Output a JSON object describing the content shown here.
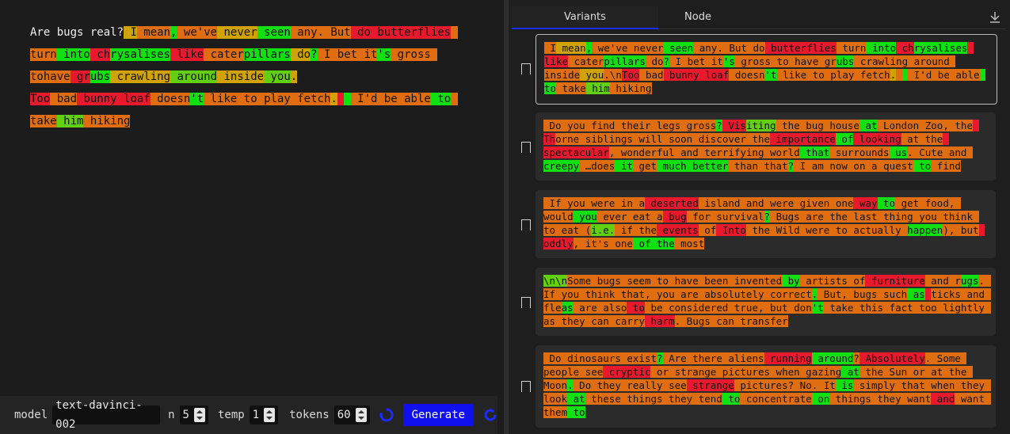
{
  "colors": {
    "red": "#e8192d",
    "orange": "#e06d10",
    "amber": "#d0a300",
    "olive": "#a6c010",
    "green": "#10e010",
    "lime": "#62d010"
  },
  "editor": {
    "prompt": "Are bugs real?",
    "tokens": [
      [
        " I",
        "a"
      ],
      [
        " mean",
        "o"
      ],
      [
        ",",
        "g"
      ],
      [
        " we",
        "o"
      ],
      [
        "'ve",
        "o"
      ],
      [
        " never",
        "a"
      ],
      [
        " seen",
        "g"
      ],
      [
        " any",
        "o"
      ],
      [
        ".",
        "o"
      ],
      [
        " But",
        "o"
      ],
      [
        " do",
        "r"
      ],
      [
        " butterflies",
        "r"
      ],
      [
        " ",
        "o"
      ],
      [
        "turn",
        "o"
      ],
      [
        " into",
        "g"
      ],
      [
        " ch",
        "r"
      ],
      [
        "rysalises",
        "g"
      ],
      [
        " like",
        "r"
      ],
      [
        " cater",
        "o"
      ],
      [
        "pillars",
        "g"
      ],
      [
        " do",
        "a"
      ],
      [
        "?",
        "g"
      ],
      [
        " I",
        "o"
      ],
      [
        " bet",
        "o"
      ],
      [
        " it",
        "o"
      ],
      [
        "'s",
        "g"
      ],
      [
        " gross",
        "o"
      ],
      [
        " to",
        "o"
      ],
      [
        "have",
        "o"
      ],
      [
        " gr",
        "r"
      ],
      [
        "ubs",
        "g"
      ],
      [
        " crawling",
        "a"
      ],
      [
        " around",
        "l"
      ],
      [
        " inside",
        "a"
      ],
      [
        " you",
        "l"
      ],
      [
        ".\n",
        "a"
      ],
      [
        "Too",
        "r"
      ],
      [
        " bad",
        "o"
      ],
      [
        " bunny",
        "r"
      ],
      [
        " loaf",
        "r"
      ],
      [
        " doesn",
        "o"
      ],
      [
        "'t",
        "g"
      ],
      [
        " like",
        "o"
      ],
      [
        " to",
        "o"
      ],
      [
        " play",
        "o"
      ],
      [
        " fetch",
        "o"
      ],
      [
        ".",
        "a"
      ],
      [
        " ",
        "r"
      ],
      [
        " ",
        "g"
      ],
      [
        " I",
        "o"
      ],
      [
        "'d",
        "o"
      ],
      [
        " be",
        "o"
      ],
      [
        " able",
        "o"
      ],
      [
        " to",
        "g"
      ],
      [
        " ",
        "o"
      ],
      [
        "take",
        "o"
      ],
      [
        " him",
        "l"
      ],
      [
        " hiking",
        "o"
      ]
    ]
  },
  "controls": {
    "model_label": "model",
    "model_value": "text-davinci-002",
    "n_label": "n",
    "n_value": "5",
    "temp_label": "temp",
    "temp_value": "1",
    "tokens_label": "tokens",
    "tokens_value": "60",
    "generate_label": "Generate"
  },
  "tabs": {
    "variants": "Variants",
    "node": "Node"
  },
  "variants": [
    {
      "tokens": [
        [
          " I",
          "o"
        ],
        [
          " mean",
          "a"
        ],
        [
          ",",
          "g"
        ],
        [
          " we",
          "o"
        ],
        [
          "'ve",
          "o"
        ],
        [
          " never",
          "o"
        ],
        [
          " seen",
          "g"
        ],
        [
          " any",
          "o"
        ],
        [
          ".",
          "o"
        ],
        [
          " But",
          "o"
        ],
        [
          " do",
          "o"
        ],
        [
          " butterflies",
          "r"
        ],
        [
          " turn",
          "o"
        ],
        [
          " into",
          "g"
        ],
        [
          " ch",
          "r"
        ],
        [
          "rysalises",
          "g"
        ],
        [
          " ",
          "r"
        ],
        [
          "like",
          "r"
        ],
        [
          " cater",
          "o"
        ],
        [
          "pillars",
          "g"
        ],
        [
          " do",
          "o"
        ],
        [
          "?",
          "g"
        ],
        [
          " I",
          "o"
        ],
        [
          " bet",
          "o"
        ],
        [
          " it",
          "o"
        ],
        [
          "'s",
          "g"
        ],
        [
          " gross",
          "o"
        ],
        [
          " to",
          "o"
        ],
        [
          " have",
          "o"
        ],
        [
          " gr",
          "o"
        ],
        [
          "ubs",
          "g"
        ],
        [
          " crawling",
          "o"
        ],
        [
          " around",
          "o"
        ],
        [
          " inside",
          "o"
        ],
        [
          " you",
          "a"
        ],
        [
          ".\\n",
          "o"
        ],
        [
          "Too",
          "r"
        ],
        [
          " bad",
          "o"
        ],
        [
          " bunny",
          "r"
        ],
        [
          " loaf",
          "r"
        ],
        [
          " doesn",
          "o"
        ],
        [
          "'t",
          "g"
        ],
        [
          " like",
          "o"
        ],
        [
          " to",
          "o"
        ],
        [
          " play",
          "o"
        ],
        [
          " fetch",
          "o"
        ],
        [
          ".",
          "a"
        ],
        [
          " ",
          "o"
        ],
        [
          " ",
          "g"
        ],
        [
          " I",
          "o"
        ],
        [
          "'d",
          "o"
        ],
        [
          " be",
          "o"
        ],
        [
          " ",
          "o"
        ],
        [
          "able",
          "o"
        ],
        [
          " to",
          "g"
        ],
        [
          " take",
          "o"
        ],
        [
          " him",
          "l"
        ],
        [
          " hiking",
          "o"
        ]
      ]
    },
    {
      "tokens": [
        [
          " Do",
          "o"
        ],
        [
          " you",
          "o"
        ],
        [
          " find",
          "o"
        ],
        [
          " their",
          "o"
        ],
        [
          " legs",
          "o"
        ],
        [
          " gross",
          "o"
        ],
        [
          "?",
          "g"
        ],
        [
          " Vis",
          "r"
        ],
        [
          "iting",
          "l"
        ],
        [
          " the",
          "o"
        ],
        [
          " bug",
          "o"
        ],
        [
          " house",
          "o"
        ],
        [
          " at",
          "g"
        ],
        [
          " London",
          "o"
        ],
        [
          " Zoo",
          "o"
        ],
        [
          ",",
          "o"
        ],
        [
          " ",
          "o"
        ],
        [
          "the",
          "o"
        ],
        [
          " Th",
          "r"
        ],
        [
          "orne",
          "o"
        ],
        [
          " siblings",
          "o"
        ],
        [
          " will",
          "o"
        ],
        [
          " soon",
          "o"
        ],
        [
          " discover",
          "o"
        ],
        [
          " the",
          "o"
        ],
        [
          " importance",
          "r"
        ],
        [
          " of",
          "g"
        ],
        [
          " looking",
          "r"
        ],
        [
          " at",
          "o"
        ],
        [
          " the",
          "o"
        ],
        [
          " ",
          "r"
        ],
        [
          "spectacular",
          "r"
        ],
        [
          ",",
          "o"
        ],
        [
          " wonderful",
          "o"
        ],
        [
          " and",
          "o"
        ],
        [
          " terrifying",
          "o"
        ],
        [
          " world",
          "o"
        ],
        [
          " that",
          "g"
        ],
        [
          " surrounds",
          "o"
        ],
        [
          " us",
          "g"
        ],
        [
          ".",
          "o"
        ],
        [
          " Cute",
          "o"
        ],
        [
          " and",
          "o"
        ],
        [
          " ",
          "o"
        ],
        [
          "creepy",
          "g"
        ],
        [
          " …",
          "o"
        ],
        [
          "does",
          "o"
        ],
        [
          " it",
          "g"
        ],
        [
          " get",
          "o"
        ],
        [
          " much",
          "g"
        ],
        [
          " better",
          "g"
        ],
        [
          " than",
          "o"
        ],
        [
          " that",
          "o"
        ],
        [
          "?",
          "g"
        ],
        [
          " I",
          "o"
        ],
        [
          " am",
          "o"
        ],
        [
          " now",
          "o"
        ],
        [
          " on",
          "o"
        ],
        [
          " a",
          "o"
        ],
        [
          " quest",
          "o"
        ],
        [
          " to",
          "g"
        ],
        [
          " find",
          "o"
        ]
      ]
    },
    {
      "tokens": [
        [
          " If",
          "o"
        ],
        [
          " you",
          "o"
        ],
        [
          " were",
          "o"
        ],
        [
          " in",
          "o"
        ],
        [
          " a",
          "o"
        ],
        [
          " deserted",
          "r"
        ],
        [
          " island",
          "o"
        ],
        [
          " and",
          "o"
        ],
        [
          " were",
          "o"
        ],
        [
          " given",
          "o"
        ],
        [
          " one",
          "o"
        ],
        [
          " way",
          "r"
        ],
        [
          " to",
          "g"
        ],
        [
          " get",
          "o"
        ],
        [
          " food",
          "o"
        ],
        [
          ",",
          "o"
        ],
        [
          " ",
          "o"
        ],
        [
          "would",
          "o"
        ],
        [
          " you",
          "g"
        ],
        [
          " ever",
          "o"
        ],
        [
          " eat",
          "o"
        ],
        [
          " a",
          "o"
        ],
        [
          " bug",
          "r"
        ],
        [
          " for",
          "o"
        ],
        [
          " survival",
          "o"
        ],
        [
          "?",
          "g"
        ],
        [
          " Bugs",
          "o"
        ],
        [
          " are",
          "o"
        ],
        [
          " the",
          "o"
        ],
        [
          " last",
          "o"
        ],
        [
          " thing",
          "o"
        ],
        [
          " you",
          "o"
        ],
        [
          " ",
          "o"
        ],
        [
          "think",
          "o"
        ],
        [
          " to",
          "o"
        ],
        [
          " eat",
          "o"
        ],
        [
          " (",
          "o"
        ],
        [
          "i.e.",
          "l"
        ],
        [
          " if",
          "o"
        ],
        [
          " the",
          "o"
        ],
        [
          " events",
          "r"
        ],
        [
          " of",
          "o"
        ],
        [
          " Into",
          "r"
        ],
        [
          " the",
          "o"
        ],
        [
          " Wild",
          "o"
        ],
        [
          " were",
          "o"
        ],
        [
          " to",
          "o"
        ],
        [
          " actually",
          "o"
        ],
        [
          " ",
          "o"
        ],
        [
          "happen",
          "g"
        ],
        [
          "),",
          "o"
        ],
        [
          " but",
          "o"
        ],
        [
          " oddly",
          "r"
        ],
        [
          ",",
          "o"
        ],
        [
          " it",
          "o"
        ],
        [
          "'s",
          "o"
        ],
        [
          " one",
          "o"
        ],
        [
          " of",
          "g"
        ],
        [
          " the",
          "g"
        ],
        [
          " most",
          "o"
        ]
      ]
    },
    {
      "tokens": [
        [
          "\\n\\n",
          "l"
        ],
        [
          "Some",
          "o"
        ],
        [
          " bugs",
          "o"
        ],
        [
          " seem",
          "o"
        ],
        [
          " to",
          "o"
        ],
        [
          " have",
          "o"
        ],
        [
          " been",
          "o"
        ],
        [
          " invented",
          "o"
        ],
        [
          " by",
          "g"
        ],
        [
          " artists",
          "o"
        ],
        [
          " of",
          "o"
        ],
        [
          " furniture",
          "r"
        ],
        [
          " and",
          "o"
        ],
        [
          " ",
          "o"
        ],
        [
          "r",
          "o"
        ],
        [
          "ugs",
          "g"
        ],
        [
          ".",
          "o"
        ],
        [
          " If",
          "o"
        ],
        [
          " you",
          "o"
        ],
        [
          " think",
          "o"
        ],
        [
          " that",
          "o"
        ],
        [
          ",",
          "o"
        ],
        [
          " you",
          "o"
        ],
        [
          " are",
          "o"
        ],
        [
          " absolutely",
          "o"
        ],
        [
          " correct",
          "o"
        ],
        [
          ".",
          "g"
        ],
        [
          " But",
          "o"
        ],
        [
          ",",
          "o"
        ],
        [
          " bugs",
          "o"
        ],
        [
          " such",
          "o"
        ],
        [
          " as",
          "g"
        ],
        [
          " ",
          "r"
        ],
        [
          "ticks",
          "o"
        ],
        [
          " and",
          "o"
        ],
        [
          " fle",
          "o"
        ],
        [
          "as",
          "g"
        ],
        [
          " are",
          "o"
        ],
        [
          " also",
          "o"
        ],
        [
          " to",
          "r"
        ],
        [
          " be",
          "o"
        ],
        [
          " considered",
          "o"
        ],
        [
          " true",
          "o"
        ],
        [
          ",",
          "o"
        ],
        [
          " but",
          "o"
        ],
        [
          " don",
          "o"
        ],
        [
          "'t",
          "g"
        ],
        [
          " take",
          "o"
        ],
        [
          " this",
          "o"
        ],
        [
          " ",
          "o"
        ],
        [
          "fact",
          "o"
        ],
        [
          " too",
          "o"
        ],
        [
          " lightly",
          "o"
        ],
        [
          " as",
          "o"
        ],
        [
          " they",
          "o"
        ],
        [
          " can",
          "o"
        ],
        [
          " carry",
          "o"
        ],
        [
          " harm",
          "r"
        ],
        [
          ".",
          "o"
        ],
        [
          " Bugs",
          "o"
        ],
        [
          " can",
          "o"
        ],
        [
          " transfer",
          "o"
        ]
      ]
    },
    {
      "tokens": [
        [
          " Do",
          "o"
        ],
        [
          " dinosaurs",
          "o"
        ],
        [
          " exist",
          "o"
        ],
        [
          "?",
          "g"
        ],
        [
          " Are",
          "o"
        ],
        [
          " there",
          "o"
        ],
        [
          " aliens",
          "o"
        ],
        [
          " running",
          "r"
        ],
        [
          " around",
          "g"
        ],
        [
          "?",
          "o"
        ],
        [
          " Absolutely",
          "r"
        ],
        [
          ".",
          "o"
        ],
        [
          " Some",
          "o"
        ],
        [
          " ",
          "o"
        ],
        [
          "people",
          "o"
        ],
        [
          " see",
          "o"
        ],
        [
          " cryptic",
          "r"
        ],
        [
          " or",
          "o"
        ],
        [
          " strange",
          "o"
        ],
        [
          " pictures",
          "o"
        ],
        [
          " when",
          "o"
        ],
        [
          " gazing",
          "o"
        ],
        [
          " at",
          "g"
        ],
        [
          " the",
          "o"
        ],
        [
          " Sun",
          "o"
        ],
        [
          " or",
          "o"
        ],
        [
          " at",
          "o"
        ],
        [
          " the",
          "o"
        ],
        [
          " ",
          "o"
        ],
        [
          "Moon",
          "o"
        ],
        [
          ".",
          "g"
        ],
        [
          " Do",
          "o"
        ],
        [
          " they",
          "o"
        ],
        [
          " really",
          "o"
        ],
        [
          " see",
          "o"
        ],
        [
          " strange",
          "r"
        ],
        [
          " pictures",
          "o"
        ],
        [
          "?",
          "o"
        ],
        [
          " No",
          "o"
        ],
        [
          ".",
          "o"
        ],
        [
          " It",
          "o"
        ],
        [
          " is",
          "g"
        ],
        [
          " simply",
          "o"
        ],
        [
          " that",
          "o"
        ],
        [
          " when",
          "o"
        ],
        [
          " ",
          "o"
        ],
        [
          "they",
          "o"
        ],
        [
          " look",
          "o"
        ],
        [
          " at",
          "g"
        ],
        [
          " these",
          "o"
        ],
        [
          " things",
          "o"
        ],
        [
          " they",
          "o"
        ],
        [
          " tend",
          "o"
        ],
        [
          " to",
          "g"
        ],
        [
          " concentrate",
          "o"
        ],
        [
          " on",
          "g"
        ],
        [
          " things",
          "o"
        ],
        [
          " they",
          "o"
        ],
        [
          " want",
          "o"
        ],
        [
          " ",
          "r"
        ],
        [
          "and",
          "r"
        ],
        [
          " want",
          "o"
        ],
        [
          " them",
          "o"
        ],
        [
          " to",
          "g"
        ]
      ]
    }
  ]
}
